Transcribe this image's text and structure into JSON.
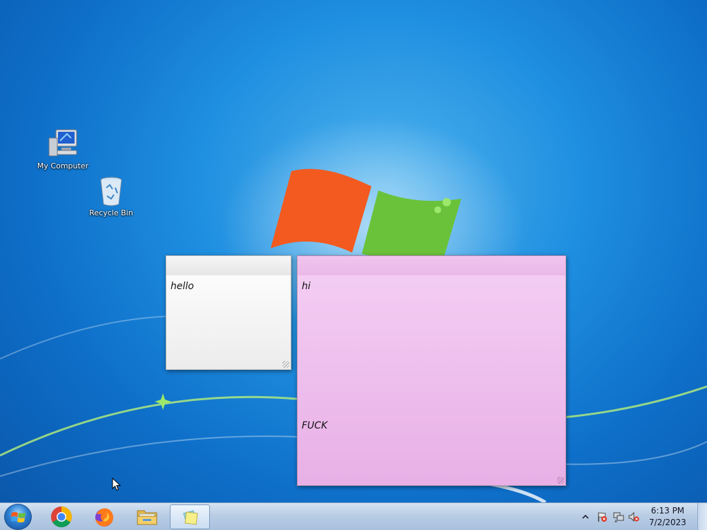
{
  "desktop": {
    "icons": [
      {
        "label": "My Computer",
        "icon": "computer-icon"
      },
      {
        "label": "Recycle Bin",
        "icon": "recycle-bin-icon"
      }
    ]
  },
  "notes": [
    {
      "color": "#f2f2f2",
      "text": "hello"
    },
    {
      "color": "#efc0ee",
      "text": "hi\n\n\n\n\n\n\n\n\n\n\n\nFUCK"
    }
  ],
  "taskbar": {
    "pinned": [
      {
        "name": "Google Chrome",
        "icon": "chrome-icon"
      },
      {
        "name": "Firefox",
        "icon": "firefox-icon"
      },
      {
        "name": "Windows Explorer",
        "icon": "folder-icon"
      },
      {
        "name": "Sticky Notes",
        "icon": "sticky-notes-icon"
      }
    ],
    "clock": {
      "time": "6:13 PM",
      "date": "7/2/2023"
    }
  },
  "colors": {
    "accent": "#1f8fe0",
    "taskbar": "#b9cde4"
  }
}
